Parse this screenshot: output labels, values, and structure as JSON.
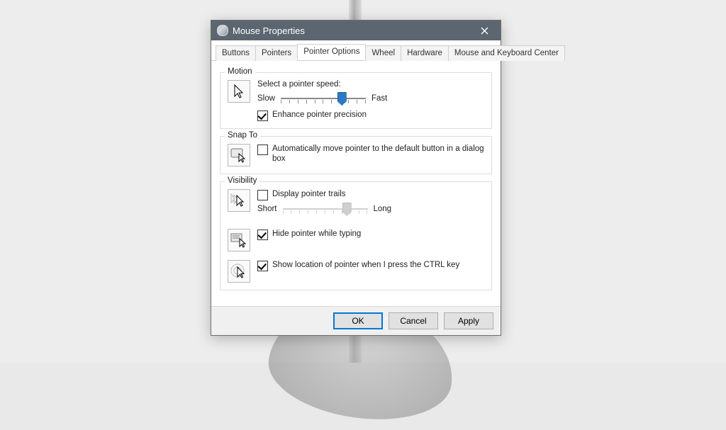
{
  "window": {
    "title": "Mouse Properties"
  },
  "tabs": {
    "items": [
      "Buttons",
      "Pointers",
      "Pointer Options",
      "Wheel",
      "Hardware",
      "Mouse and Keyboard Center"
    ],
    "active_index": 2
  },
  "motion": {
    "legend": "Motion",
    "prompt": "Select a pointer speed:",
    "slow": "Slow",
    "fast": "Fast",
    "speed_percent": 78,
    "enhance_label": "Enhance pointer precision",
    "enhance_checked": true
  },
  "snapto": {
    "legend": "Snap To",
    "auto_label": "Automatically move pointer to the default button in a dialog box",
    "auto_checked": false
  },
  "visibility": {
    "legend": "Visibility",
    "trails_label": "Display pointer trails",
    "trails_checked": false,
    "short": "Short",
    "long": "Long",
    "trails_percent": 82,
    "hide_label": "Hide pointer while typing",
    "hide_checked": true,
    "ctrl_label": "Show location of pointer when I press the CTRL key",
    "ctrl_checked": true
  },
  "buttons": {
    "ok": "OK",
    "cancel": "Cancel",
    "apply": "Apply"
  }
}
